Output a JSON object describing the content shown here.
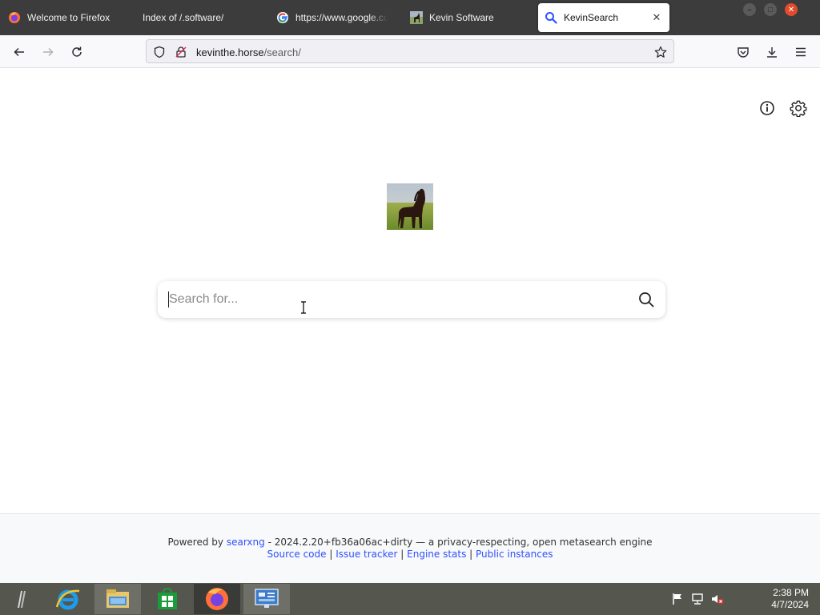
{
  "browser": {
    "tabs": [
      {
        "title": "Welcome to Firefox",
        "icon": "firefox-icon",
        "active": false
      },
      {
        "title": "Index of /.software/",
        "icon": "",
        "active": false
      },
      {
        "title": "https://www.google.co",
        "icon": "google-icon",
        "active": false
      },
      {
        "title": "Kevin Software",
        "icon": "horse-favicon",
        "active": false
      },
      {
        "title": "KevinSearch",
        "icon": "search-favicon",
        "active": true
      }
    ],
    "tab_close_glyph": "✕",
    "url": {
      "host": "kevinthe.horse",
      "path": "/search/"
    }
  },
  "page": {
    "search_placeholder": "Search for...",
    "search_value": "",
    "logo_alt": "horse logo",
    "footer": {
      "powered_by_prefix": "Powered by ",
      "powered_by_link": "searxng",
      "powered_by_suffix": " - 2024.2.20+fb36a06ac+dirty — a privacy-respecting, open metasearch engine",
      "links": [
        "Source code",
        "Issue tracker",
        "Engine stats",
        "Public instances"
      ],
      "separator": " | "
    }
  },
  "taskbar": {
    "time": "2:38 PM",
    "date": "4/7/2024",
    "apps": [
      "start-icon",
      "internet-explorer-icon",
      "file-explorer-icon",
      "store-icon",
      "firefox-icon",
      "control-panel-icon"
    ]
  },
  "colors": {
    "tabstrip": "#3c3c3c",
    "link": "#3050ff",
    "taskbar": "#55574f",
    "close": "#e04b2d"
  }
}
